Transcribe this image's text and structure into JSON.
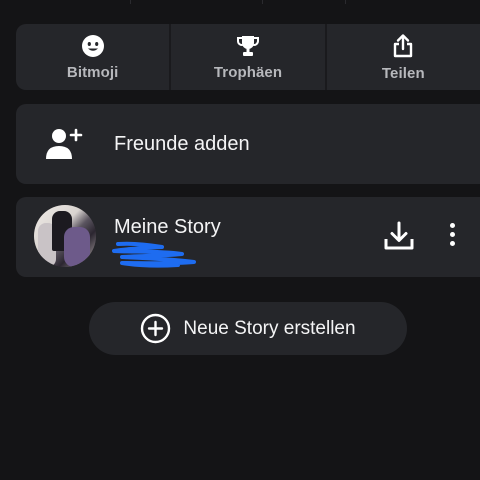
{
  "quick_actions": [
    {
      "label": "Bitmoji",
      "icon": "bitmoji-face-icon"
    },
    {
      "label": "Trophäen",
      "icon": "trophy-icon"
    },
    {
      "label": "Teilen",
      "icon": "share-icon"
    }
  ],
  "friends": {
    "label": "Freunde adden",
    "icon": "add-friend-icon"
  },
  "story": {
    "title": "Meine Story",
    "download_icon": "download-icon",
    "more_icon": "more-vertical-icon"
  },
  "new_story": {
    "label": "Neue Story erstellen",
    "icon": "plus-circle-icon"
  },
  "colors": {
    "background": "#141416",
    "card": "#25262a",
    "text": "#f4f4f5",
    "muted": "#b7b8bc",
    "redaction": "#1e6cf0"
  }
}
